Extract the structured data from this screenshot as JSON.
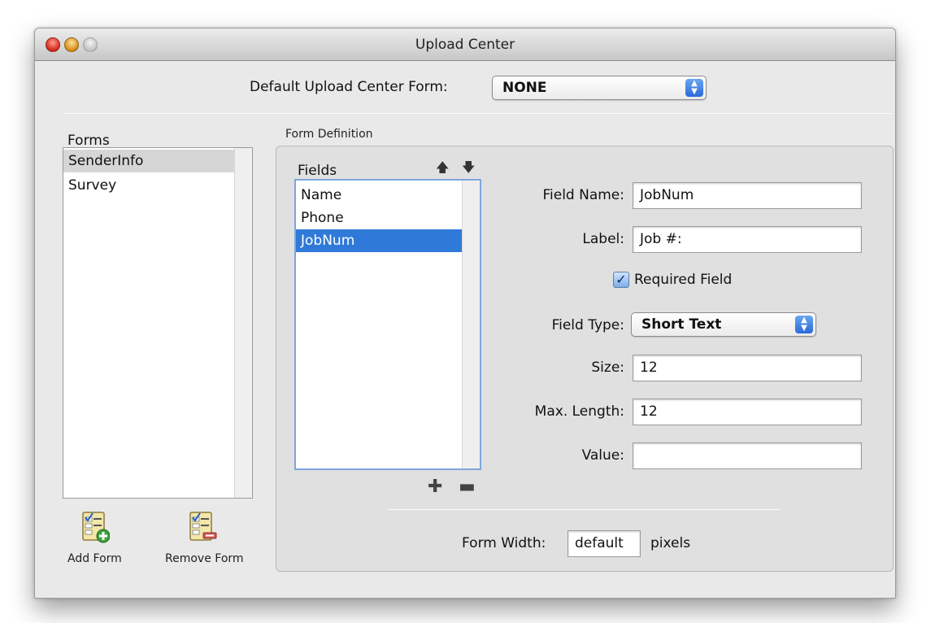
{
  "window": {
    "title": "Upload Center"
  },
  "default_form": {
    "label": "Default Upload Center Form:",
    "selected": "NONE"
  },
  "forms": {
    "title": "Forms",
    "items": [
      "SenderInfo",
      "Survey"
    ],
    "add_label": "Add Form",
    "remove_label": "Remove Form"
  },
  "form_definition": {
    "title": "Form Definition",
    "fields_title": "Fields",
    "fields": [
      "Name",
      "Phone",
      "JobNum"
    ],
    "field_name_label": "Field Name:",
    "field_name_value": "JobNum",
    "label_label": "Label:",
    "label_value": "Job #:",
    "required_label": "Required Field",
    "required_checked": true,
    "field_type_label": "Field Type:",
    "field_type_value": "Short Text",
    "size_label": "Size:",
    "size_value": "12",
    "max_length_label": "Max. Length:",
    "max_length_value": "12",
    "value_label": "Value:",
    "value_value": "",
    "form_width_label": "Form Width:",
    "form_width_value": "default",
    "form_width_unit": "pixels"
  },
  "icons": {
    "move_up": "arrow-up-icon",
    "move_down": "arrow-down-icon",
    "add_field": "plus-icon",
    "remove_field": "minus-icon"
  },
  "colors": {
    "selection_blue": "#2f7ad8",
    "selection_gray": "#d6d6d6"
  }
}
